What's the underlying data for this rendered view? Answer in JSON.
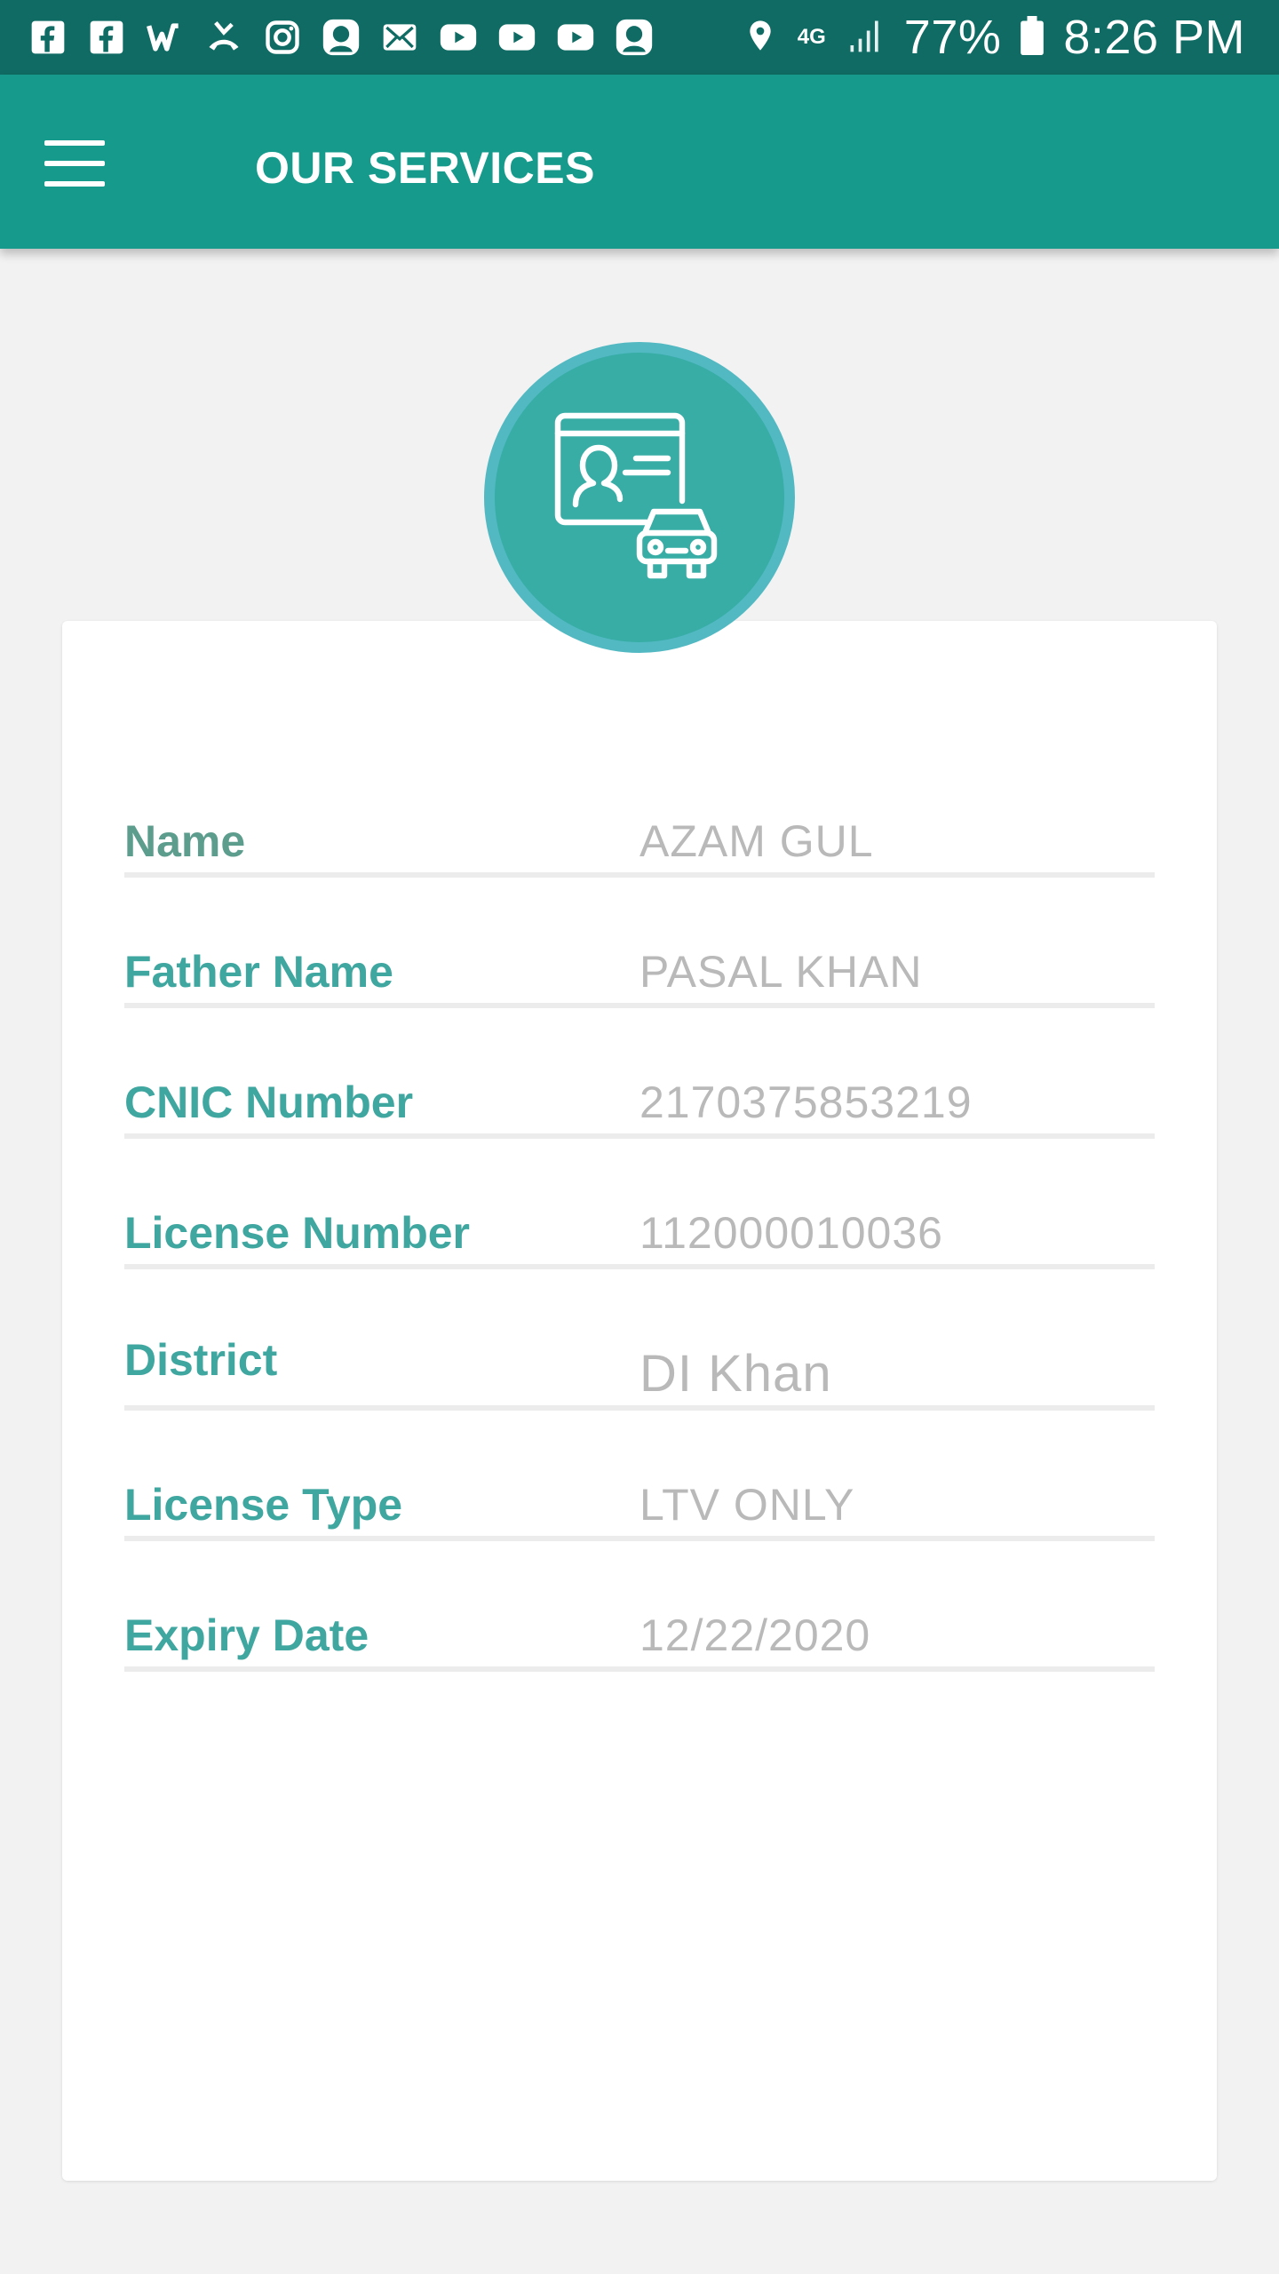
{
  "status_bar": {
    "notification_icons": [
      "facebook-icon",
      "facebook-icon",
      "w-app-icon",
      "missed-call-icon",
      "instagram-icon",
      "app-avatar-icon",
      "mail-icon",
      "youtube-icon",
      "youtube-icon",
      "youtube-icon",
      "app-avatar-icon"
    ],
    "network": "4G",
    "battery": "77%",
    "time": "8:26 PM"
  },
  "app_bar": {
    "title": "OUR SERVICES"
  },
  "service": {
    "icon": "driving-license-icon"
  },
  "details": [
    {
      "label": "Name",
      "value": "AZAM GUL"
    },
    {
      "label": "Father Name",
      "value": "PASAL KHAN"
    },
    {
      "label": "CNIC Number",
      "value": "2170375853219"
    },
    {
      "label": "License Number",
      "value": "112000010036"
    },
    {
      "label": "District",
      "value": "DI Khan"
    },
    {
      "label": "License Type",
      "value": "LTV ONLY"
    },
    {
      "label": "Expiry Date",
      "value": "12/22/2020"
    }
  ],
  "colors": {
    "status_bar": "#0f6b63",
    "app_bar": "#159a8b",
    "label": "#3fa6a0",
    "value": "#b9b9b9",
    "icon_circle": "#37ada6"
  }
}
